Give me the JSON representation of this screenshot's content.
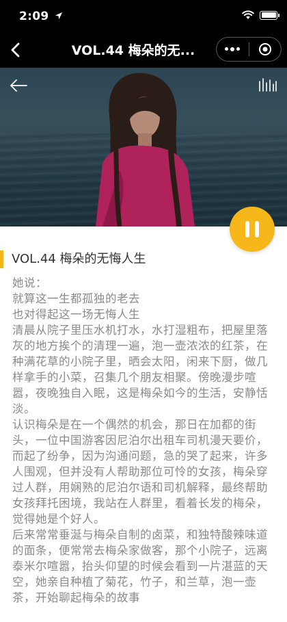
{
  "status_bar": {
    "time": "2:09"
  },
  "nav": {
    "title": "VOL.44 梅朵的无..."
  },
  "article": {
    "title": "VOL.44 梅朵的无悔人生",
    "paragraphs": [
      "她说：",
      "就算这一生都孤独的老去",
      "也对得起这一场无悔人生",
      "清晨从院子里压水机打水，水打湿粗布，把屋里落灰的地方挨个的清理一遍，泡一壶浓浓的红茶，在种满花草的小院子里，晒会太阳，闲来下厨，做几样拿手的小菜，召集几个朋友相聚。傍晚漫步喧嚣，夜晚独自入眠，这是梅朵如今的生活，安静恬淡。",
      "认识梅朵是在一个偶然的机会，那日在加都的街头，一位中国游客因尼泊尔出租车司机漫天要价，而起了纷争，因为沟通问题，急的哭了起来，许多人围观，但并没有人帮助那位可怜的女孩，梅朵穿过人群，用娴熟的尼泊尔语和司机解释，最终帮助女孩拜托困境，我站在人群里，看着长发的梅朵，觉得她是个好人。",
      "后来常常垂涎与梅朵自制的卤菜，和独特酸辣味道的面条，便常常去梅朵家做客，那个小院子，远离泰米尔喧嚣，抬头仰望的时候会看到一片湛蓝的天空，她亲自种植了菊花，竹子，和兰草，泡一壶茶，开始聊起梅朵的故事"
    ]
  },
  "colors": {
    "accent": "#f6b71a",
    "bar_bg": "#000000",
    "body_text": "#8a8a8a"
  },
  "icons": {
    "status": [
      "location-arrow-icon",
      "wifi-icon",
      "battery-icon"
    ],
    "nav": [
      "back-chevron-icon",
      "more-dots-icon",
      "capsule-close-icon"
    ],
    "hero": [
      "arrow-left-icon",
      "sound-wave-icon"
    ],
    "player": [
      "pause-icon"
    ]
  },
  "player": {
    "state": "playing"
  }
}
